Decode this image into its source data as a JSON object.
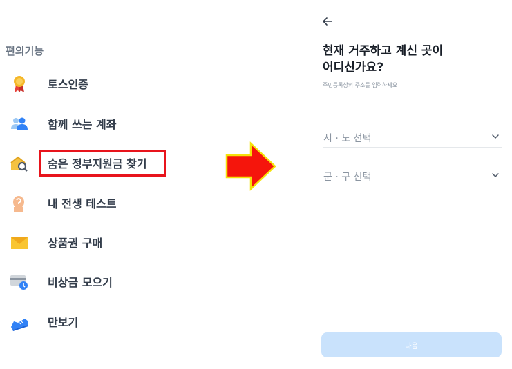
{
  "left_panel": {
    "section_title": "편의기능",
    "items": [
      {
        "label": "토스인증",
        "icon": "medal-icon"
      },
      {
        "label": "함께 쓰는 계좌",
        "icon": "people-icon"
      },
      {
        "label": "숨은 정부지원금 찾기",
        "icon": "house-search-icon",
        "highlighted": true
      },
      {
        "label": "내 전생 테스트",
        "icon": "head-question-icon"
      },
      {
        "label": "상품권 구매",
        "icon": "envelope-icon"
      },
      {
        "label": "비상금 모으기",
        "icon": "card-clock-icon"
      },
      {
        "label": "만보기",
        "icon": "sneaker-icon"
      }
    ],
    "highlight_color": "#e8141c"
  },
  "arrow": {
    "icon": "right-arrow-icon",
    "fill": "#f5150c",
    "stroke": "#f5e20a"
  },
  "right_panel": {
    "back_icon": "back-arrow-icon",
    "heading_line1": "현재 거주하고 계신 곳이",
    "heading_line2": "어디신가요?",
    "subtext": "주민등록상의 주소를 입력하세요",
    "select_city": {
      "placeholder": "시 · 도 선택"
    },
    "select_district": {
      "placeholder": "군 · 구 선택"
    },
    "next_button": "다음",
    "button_color": "#c9e2fc"
  }
}
